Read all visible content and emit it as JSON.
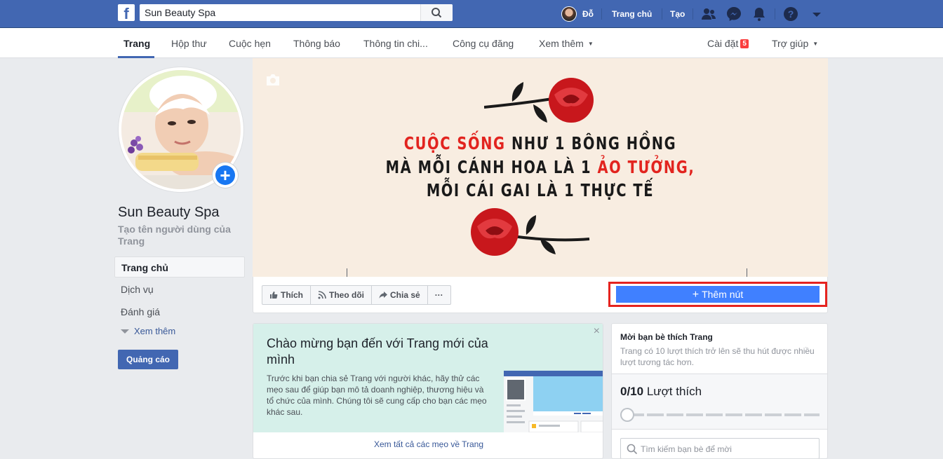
{
  "topbar": {
    "logo": "f",
    "search_value": "Sun Beauty Spa",
    "user_name": "Đỗ",
    "home_label": "Trang chủ",
    "create_label": "Tạo"
  },
  "subnav": {
    "tabs": [
      {
        "label": "Trang"
      },
      {
        "label": "Hộp thư"
      },
      {
        "label": "Cuộc hẹn"
      },
      {
        "label": "Thông báo"
      },
      {
        "label": "Thông tin chi..."
      },
      {
        "label": "Công cụ đăng"
      },
      {
        "label": "Xem thêm"
      }
    ],
    "settings_label": "Cài đặt",
    "settings_badge": "5",
    "help_label": "Trợ giúp"
  },
  "sidebar": {
    "page_name": "Sun Beauty Spa",
    "username_prompt": "Tạo tên người dùng của Trang",
    "items": [
      {
        "label": "Trang chủ"
      },
      {
        "label": "Dịch vụ"
      },
      {
        "label": "Đánh giá"
      }
    ],
    "more_label": "Xem thêm",
    "ad_button": "Quảng cáo"
  },
  "cover": {
    "line1_red": "CUỘC SỐNG",
    "line1_rest": " NHƯ 1 BÔNG HỒNG",
    "line2_start": "MÀ MỖI CÁNH HOA LÀ 1 ",
    "line2_red": "ẢO TƯỞNG,",
    "line3": "MỖI CÁI GAI LÀ 1 THỰC TẾ"
  },
  "actions": {
    "like": "Thích",
    "follow": "Theo dõi",
    "share": "Chia sẻ",
    "more": "···",
    "add_button": "Thêm nút"
  },
  "welcome": {
    "title": "Chào mừng bạn đến với Trang mới của mình",
    "body": "Trước khi bạn chia sẻ Trang với người khác, hãy thử các mẹo sau để giúp bạn mô tả doanh nghiệp, thương hiệu và tổ chức của mình. Chúng tôi sẽ cung cấp cho bạn các mẹo khác sau.",
    "close": "×",
    "link": "Xem tất cả các mẹo về Trang"
  },
  "invite": {
    "title": "Mời bạn bè thích Trang",
    "description": "Trang có 10 lượt thích trở lên sẽ thu hút được nhiều lượt tương tác hơn.",
    "count": "0/10",
    "count_label": " Lượt thích",
    "progress_fraction": 0,
    "search_placeholder": "Tìm kiếm bạn bè để mời"
  },
  "colors": {
    "brand_blue": "#4267b2",
    "button_blue": "#4080ff",
    "highlight_red": "#e5231f",
    "cover_red": "#e2241f"
  }
}
